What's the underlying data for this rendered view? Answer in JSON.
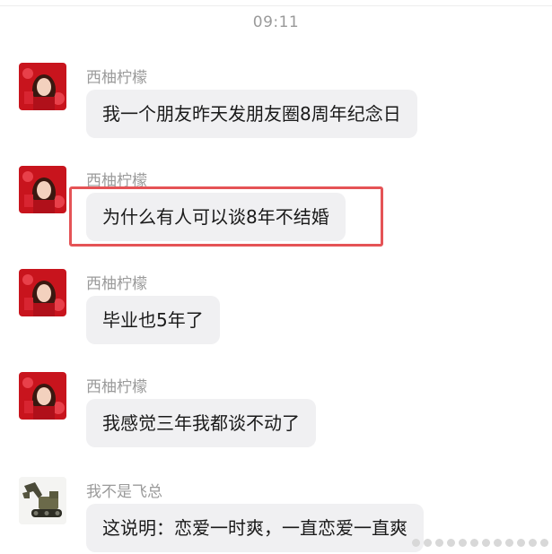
{
  "chat": {
    "timestamp": "09:11",
    "messages": [
      {
        "sender": "西柚柠檬",
        "text": "我一个朋友昨天发朋友圈8周年纪念日",
        "avatar": "girl-red-avatar"
      },
      {
        "sender": "西柚柠檬",
        "text": "为什么有人可以谈8年不结婚",
        "avatar": "girl-red-avatar",
        "highlighted": true
      },
      {
        "sender": "西柚柠檬",
        "text": "毕业也5年了",
        "avatar": "girl-red-avatar"
      },
      {
        "sender": "西柚柠檬",
        "text": "我感觉三年我都谈不动了",
        "avatar": "girl-red-avatar"
      },
      {
        "sender": "我不是飞总",
        "text": "这说明：恋爱一时爽，一直恋爱一直爽",
        "avatar": "excavator-avatar"
      }
    ]
  },
  "colors": {
    "bubble": "#f0f0f2",
    "highlight_border": "#e55356",
    "sender_text": "#9b9b9b",
    "timestamp_text": "#9a9a9a"
  }
}
